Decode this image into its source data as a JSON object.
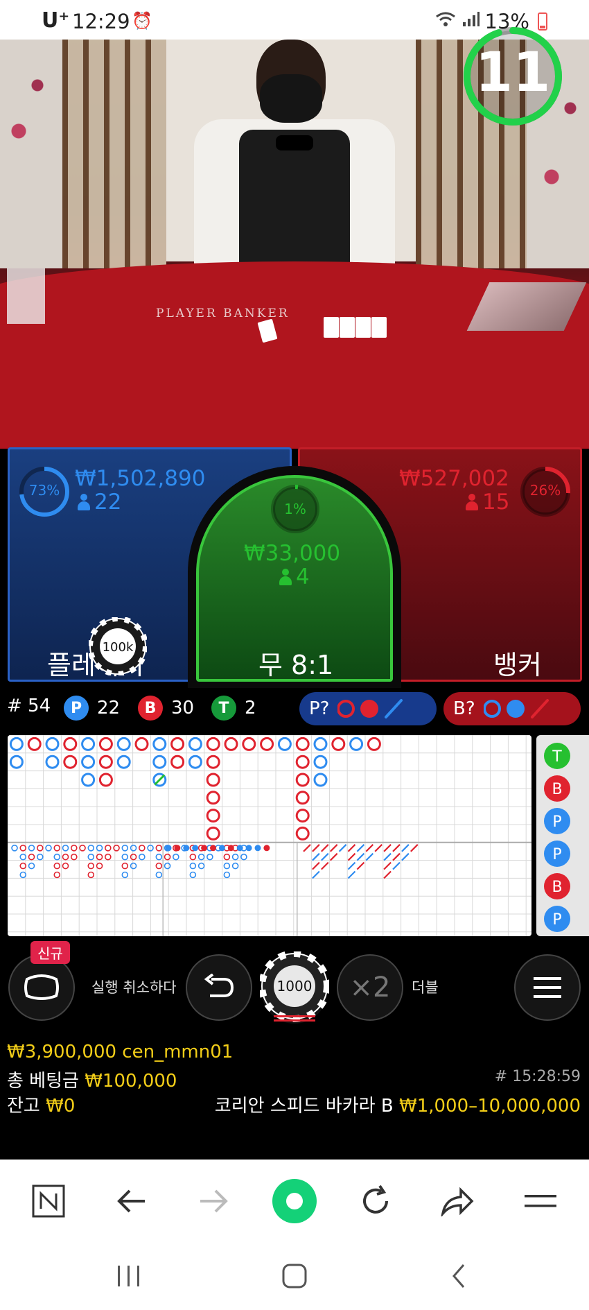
{
  "status_bar": {
    "carrier": "U⁺",
    "time": "12:29",
    "battery": "13%"
  },
  "video": {
    "table_text": "PLAYER    BANKER",
    "countdown": "11",
    "countdown_fraction": 0.95
  },
  "bets": {
    "player": {
      "percent": "73%",
      "percent_value": 0.73,
      "amount": "₩1,502,890",
      "players": "22",
      "label": "플레이어"
    },
    "tie": {
      "percent": "1%",
      "percent_value": 0.01,
      "amount": "₩33,000",
      "players": "4",
      "label": "무 8:1"
    },
    "banker": {
      "percent": "26%",
      "percent_value": 0.26,
      "amount": "₩527,002",
      "players": "15",
      "label": "뱅커"
    },
    "placed_chip": "100k"
  },
  "scoreboard": {
    "round": "# 54",
    "player_badge": "P",
    "player_count": "22",
    "banker_badge": "B",
    "banker_count": "30",
    "tie_badge": "T",
    "tie_count": "2",
    "predict_player": "P?",
    "predict_banker": "B?"
  },
  "big_road": [
    [
      "P",
      "P"
    ],
    [
      "B"
    ],
    [
      "P",
      "P"
    ],
    [
      "B",
      "B"
    ],
    [
      "P",
      "P",
      "P"
    ],
    [
      "B",
      "B",
      "B"
    ],
    [
      "P",
      "P"
    ],
    [
      "B"
    ],
    [
      "P",
      "P",
      "T"
    ],
    [
      "B",
      "B"
    ],
    [
      "P",
      "P"
    ],
    [
      "B",
      "B",
      "B",
      "B",
      "B",
      "B"
    ],
    [
      "B"
    ],
    [
      "B"
    ],
    [
      "B"
    ],
    [
      "P"
    ],
    [
      "B",
      "B",
      "B",
      "B",
      "B",
      "B"
    ],
    [
      "P",
      "P",
      "P"
    ],
    [
      "B"
    ],
    [
      "P"
    ],
    [
      "B"
    ]
  ],
  "side_road": [
    "T",
    "B",
    "P",
    "P",
    "B",
    "P"
  ],
  "controls": {
    "new_badge": "신규",
    "undo_label": "실행 취소하다",
    "chip_value": "1000",
    "double_symbol": "×2",
    "double_label": "더블"
  },
  "info": {
    "balance_user": "₩3,900,000 cen_mmn01",
    "total_bet_label": "총 베팅금",
    "total_bet": "₩100,000",
    "balance_label": "잔고",
    "balance": "₩0",
    "round_time": "# 15:28:59",
    "table_name": "코리안 스피드 바카라 B",
    "limits": "₩1,000–10,000,000"
  },
  "colors": {
    "player": "#2f8cf0",
    "banker": "#e0232f",
    "tie": "#26c030",
    "gold": "#f2cd18"
  }
}
